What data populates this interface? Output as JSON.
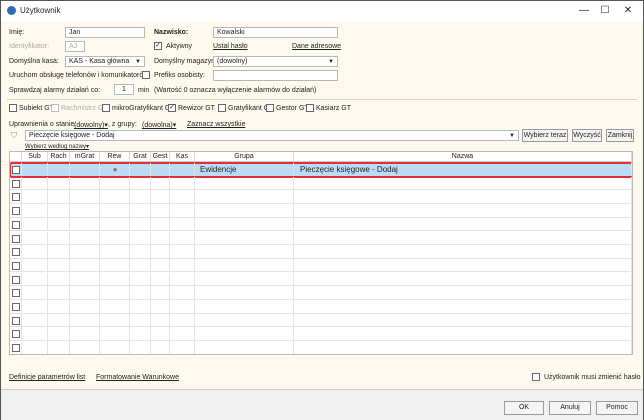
{
  "window": {
    "title": "Użytkownik"
  },
  "form": {
    "imie_label": "Imię:",
    "imie": "Jan",
    "nazwisko_label": "Nazwisko:",
    "nazwisko": "Kowalski",
    "identyfikator_label": "Identyfikator:",
    "identyfikator": "AJ",
    "aktywny_label": "Aktywny",
    "aktywny": true,
    "ustal_haslo": "Ustal hasło",
    "dane_adresowe": "Dane adresowe",
    "kasa_label": "Domyślna kasa:",
    "kasa": "KAS - Kasa główna",
    "magazyn_label": "Domyślny magazyn:",
    "magazyn": "(dowolny)",
    "telefony_label": "Uruchom obsługę telefonów i komunikatorów",
    "prefiks_label": "Prefiks osobisty:",
    "prefiks": "",
    "alarmy_label": "Sprawdzaj alarmy działań co:",
    "alarmy": "1",
    "alarmy_unit": "min",
    "alarmy_note": "(Wartość 0 oznacza wyłączenie alarmów do działań)"
  },
  "products": [
    {
      "label": "Subiekt GT",
      "checked": false,
      "disabled": false
    },
    {
      "label": "Rachmistrz GT",
      "checked": false,
      "disabled": true
    },
    {
      "label": "mikroGratyfikant GT",
      "checked": false,
      "disabled": false
    },
    {
      "label": "Rewizor GT",
      "checked": true,
      "disabled": false
    },
    {
      "label": "Gratyfikant GT",
      "checked": false,
      "disabled": false
    },
    {
      "label": "Gestor GT",
      "checked": false,
      "disabled": false
    },
    {
      "label": "Kasiarz GT",
      "checked": false,
      "disabled": false
    }
  ],
  "filter": {
    "stan_label": "Uprawnienia o stanie:",
    "stan": "(dowolny)",
    "grupa_label": ", z grupy:",
    "grupa": "(dowolna)",
    "zaznacz": "Zaznacz wszystkie",
    "search": "Pieczęcie księgowe - Dodaj",
    "wybierz_teraz": "Wybierz teraz",
    "wyczysc": "Wyczyść",
    "zamknij": "Zamknij",
    "wybierz_nazwy": "Wybierz według nazwy"
  },
  "grid": {
    "columns": [
      "Sub",
      "Rach",
      "mGrat",
      "Rew",
      "Grat",
      "Gest",
      "Kas",
      "Grupa",
      "Nazwa"
    ],
    "rows": [
      {
        "rew": "●",
        "grupa": "Ewidencje",
        "nazwa": "Pieczęcie księgowe - Dodaj",
        "selected": true
      }
    ]
  },
  "footer": {
    "definicje": "Definicje parametrów list",
    "formatowanie": "Formatowanie Warunkowe",
    "musi_zmienic": "Użytkownik musi zmienić hasło"
  },
  "buttons": {
    "ok": "OK",
    "anuluj": "Anuluj",
    "pomoc": "Pomoc"
  }
}
